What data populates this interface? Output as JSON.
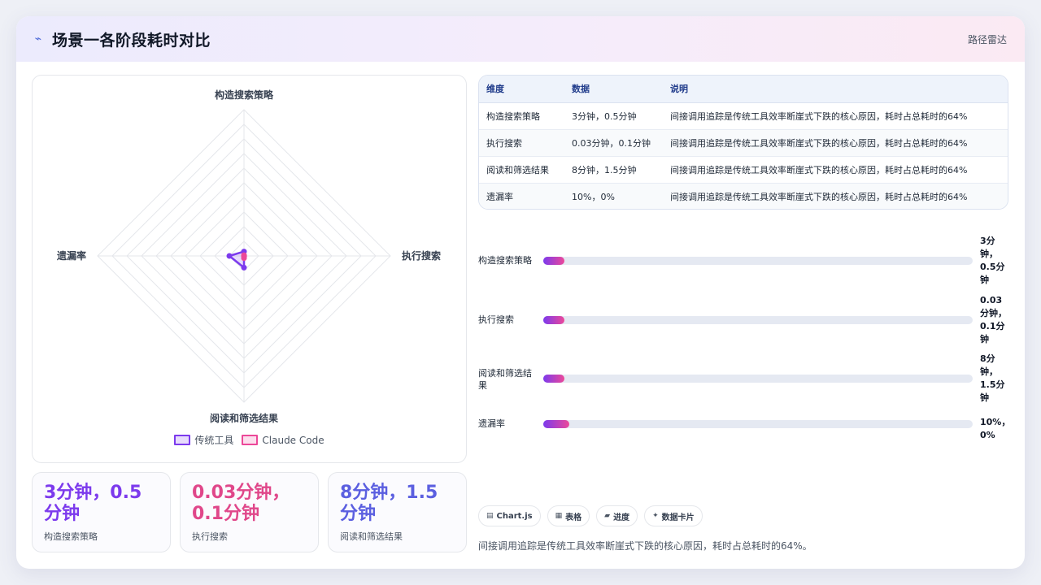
{
  "header": {
    "icon": "chart-line-icon",
    "title": "场景一各阶段耗时对比",
    "chart_type_label": "路径雷达"
  },
  "colors": {
    "series_traditional": "#7c3aed",
    "series_claude": "#ec4899",
    "stat_1": "#7c3aed",
    "stat_2": "#e0478a",
    "stat_3": "#5b5fe0"
  },
  "chart_data": {
    "type": "radar",
    "axes": [
      "构造搜索策略",
      "执行搜索",
      "阅读和筛选结果",
      "遗漏率"
    ],
    "series": [
      {
        "name": "传统工具",
        "values": [
          3,
          0.03,
          8,
          10
        ]
      },
      {
        "name": "Claude Code",
        "values": [
          0.5,
          0.1,
          1.5,
          0
        ]
      }
    ],
    "rlim": [
      0,
      100
    ],
    "grid": true,
    "legend_position": "bottom"
  },
  "stats": [
    {
      "value": "3分钟，0.5分钟",
      "label": "构造搜索策略"
    },
    {
      "value": "0.03分钟，0.1分钟",
      "label": "执行搜索"
    },
    {
      "value": "8分钟，1.5分钟",
      "label": "阅读和筛选结果"
    }
  ],
  "table": {
    "headers": [
      "维度",
      "数据",
      "说明"
    ],
    "rows": [
      [
        "构造搜索策略",
        "3分钟，0.5分钟",
        "间接调用追踪是传统工具效率断崖式下跌的核心原因，耗时占总耗时的64%"
      ],
      [
        "执行搜索",
        "0.03分钟，0.1分钟",
        "间接调用追踪是传统工具效率断崖式下跌的核心原因，耗时占总耗时的64%"
      ],
      [
        "阅读和筛选结果",
        "8分钟，1.5分钟",
        "间接调用追踪是传统工具效率断崖式下跌的核心原因，耗时占总耗时的64%"
      ],
      [
        "遗漏率",
        "10%，0%",
        "间接调用追踪是传统工具效率断崖式下跌的核心原因，耗时占总耗时的64%"
      ]
    ]
  },
  "progress": [
    {
      "label": "构造搜索策略",
      "value": "3分钟，0.5分钟",
      "fraction": 0.05
    },
    {
      "label": "执行搜索",
      "value": "0.03分钟，0.1分钟",
      "fraction": 0.05
    },
    {
      "label": "阅读和筛选结果",
      "value": "8分钟，1.5分钟",
      "fraction": 0.05
    },
    {
      "label": "遗漏率",
      "value": "10%，0%",
      "fraction": 0.06
    }
  ],
  "chips": [
    {
      "icon": "chart-icon",
      "label": "Chart.js"
    },
    {
      "icon": "table-icon",
      "label": "表格"
    },
    {
      "icon": "progress-icon",
      "label": "进度"
    },
    {
      "icon": "card-icon",
      "label": "数据卡片"
    }
  ],
  "footer": "间接调用追踪是传统工具效率断崖式下跌的核心原因，耗时占总耗时的64%。"
}
